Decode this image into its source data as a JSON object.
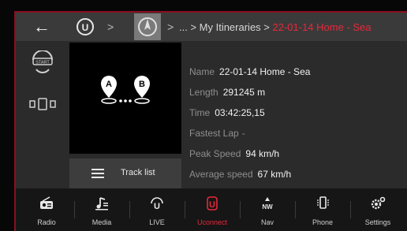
{
  "header": {
    "back_icon": "back-arrow-icon",
    "home_icon": "uconnect-u-icon",
    "nav_icon": "navigation-compass-icon",
    "separator": ">",
    "crumb_trail": "... > My Itineraries > ",
    "crumb_current": "22-01-14 Home - Sea",
    "colors": {
      "accent": "#e8283a",
      "text": "#d6d6d6"
    }
  },
  "rail": {
    "items": [
      {
        "label": "START",
        "icon": "start-icon"
      },
      {
        "label": "",
        "icon": "phone-device-icon"
      }
    ]
  },
  "map": {
    "marker_a": "A",
    "marker_b": "B",
    "tracklist_label": "Track list",
    "tracklist_icon": "list-icon"
  },
  "info": {
    "rows": [
      {
        "key": "Name",
        "value": "22-01-14 Home - Sea"
      },
      {
        "key": "Length",
        "value": "291245 m"
      },
      {
        "key": "Time",
        "value": "03:42:25,15"
      },
      {
        "key": "Fastest Lap",
        "value": "-"
      },
      {
        "key": "Peak Speed",
        "value": "94 km/h"
      },
      {
        "key": "Average speed",
        "value": "67 km/h"
      }
    ]
  },
  "bottom_bar": {
    "items": [
      {
        "label": "Radio",
        "icon": "radio-icon"
      },
      {
        "label": "Media",
        "icon": "media-icon"
      },
      {
        "label": "LIVE",
        "icon": "live-icon"
      },
      {
        "label": "Uconnect",
        "icon": "uconnect-icon"
      },
      {
        "label": "Nav",
        "icon": "nav-icon"
      },
      {
        "label": "Phone",
        "icon": "phone-icon"
      },
      {
        "label": "Settings",
        "icon": "settings-icon"
      }
    ]
  }
}
